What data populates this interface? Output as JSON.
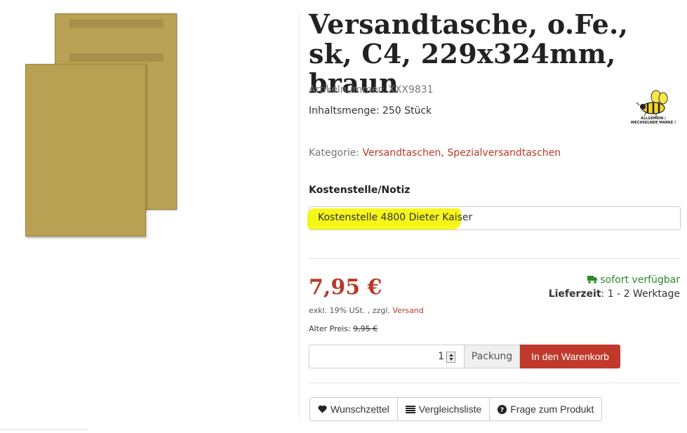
{
  "product": {
    "title": "Versandtasche, o.Fe., sk, C4, 229x324mm, braun",
    "sku_label": "Artikelnummer:",
    "sku": "XXX9831",
    "content_label": "Inhaltsmenge:",
    "content": "250 Stück",
    "category_label": "Kategorie:",
    "categories": [
      "Versandtaschen",
      "Spezialversandtaschen"
    ],
    "category_separator": ", ",
    "brand_logo_text": "ALLGEMEIN / WECHSELNDE MARKE !"
  },
  "note": {
    "label": "Kostenstelle/Notiz",
    "value": "Kostenstelle 4800 Dieter Kaiser"
  },
  "pricing": {
    "price": "7,95 €",
    "tax_text": "exkl. 19% USt. , zzgl.",
    "shipping_link": "Versand",
    "old_price_label": "Alter Preis:",
    "old_price": "9,95 €"
  },
  "availability": {
    "status": "sofort verfügbar",
    "delivery_label": "Lieferzeit",
    "delivery_value": ": 1 - 2 Werktage"
  },
  "purchase": {
    "quantity": "1",
    "unit": "Packung",
    "add_to_cart": "In den Warenkorb"
  },
  "actions": {
    "wishlist": "Wunschzettel",
    "compare": "Vergleichsliste",
    "question": "Frage zum Produkt"
  },
  "colors": {
    "accent": "#b73a2a",
    "button": "#c0392b",
    "available": "#2a8a2a",
    "highlight": "#f5f500"
  },
  "icons": {
    "truck": "truck-icon",
    "heart": "heart-icon",
    "list": "list-icon",
    "question": "question-icon"
  }
}
